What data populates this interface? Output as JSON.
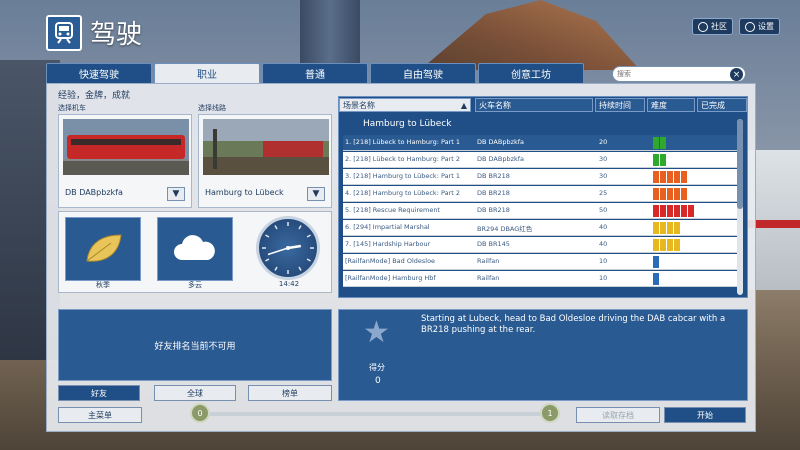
{
  "header": {
    "title": "驾驶"
  },
  "topbar": {
    "community_label": "社区",
    "settings_label": "设置"
  },
  "tabs": [
    {
      "label": "快速驾驶",
      "active": false
    },
    {
      "label": "职业",
      "active": true
    },
    {
      "label": "普通",
      "active": false
    },
    {
      "label": "自由驾驶",
      "active": false
    },
    {
      "label": "创意工坊",
      "active": false
    }
  ],
  "search": {
    "placeholder": "搜索",
    "clear_icon": "×"
  },
  "career": {
    "subheading": "经验，金牌，成就",
    "select_loco_label": "选择机车",
    "select_route_label": "选择线路",
    "loco_name": "DB DABpbzkfa",
    "route_name": "Hamburg to Lübeck",
    "filter_icon": "▼"
  },
  "conditions": {
    "season_label": "秋季",
    "weather_label": "多云",
    "time_label": "14:42"
  },
  "friends": {
    "unavailable_text": "好友排名当前不可用"
  },
  "leaderboard_buttons": {
    "friends": "好友",
    "global": "全球",
    "board": "榜单"
  },
  "footer": {
    "main_menu": "主菜单",
    "load_save": "读取存档",
    "start": "开始"
  },
  "slider": {
    "min": "0",
    "max": "1",
    "value_fraction": 1.0
  },
  "table": {
    "headers": [
      "场景名称",
      "火车名称",
      "持续时间",
      "难度",
      "已完成"
    ],
    "group": "Hamburg to Lübeck",
    "rows": [
      {
        "name": "1. [218] Lübeck to Hamburg: Part 1",
        "train": "DB DABpbzkfa",
        "duration": "20",
        "difficulty": 2,
        "color": "#2ea82e"
      },
      {
        "name": "2. [218] Lübeck to Hamburg: Part 2",
        "train": "DB DABpbzkfa",
        "duration": "30",
        "difficulty": 2,
        "color": "#2ea82e"
      },
      {
        "name": "3. [218] Hamburg to Lübeck: Part 1",
        "train": "DB BR218",
        "duration": "30",
        "difficulty": 5,
        "color": "#e86020"
      },
      {
        "name": "4. [218] Hamburg to Lübeck: Part 2",
        "train": "DB BR218",
        "duration": "25",
        "difficulty": 5,
        "color": "#e86020"
      },
      {
        "name": "5. [218] Rescue Requirement",
        "train": "DB BR218",
        "duration": "50",
        "difficulty": 6,
        "color": "#d82828"
      },
      {
        "name": "6. [294] Impartial Marshal",
        "train": "BR294 DBAG红色",
        "duration": "40",
        "difficulty": 4,
        "color": "#e8b820"
      },
      {
        "name": "7. [145] Hardship Harbour",
        "train": "DB BR145",
        "duration": "40",
        "difficulty": 4,
        "color": "#e8b820"
      },
      {
        "name": "[RailfanMode] Bad Oldesloe",
        "train": "Railfan",
        "duration": "10",
        "difficulty": 1,
        "color": "#2a6ab8"
      },
      {
        "name": "[RailfanMode] Hamburg Hbf",
        "train": "Railfan",
        "duration": "10",
        "difficulty": 1,
        "color": "#2a6ab8"
      }
    ]
  },
  "details": {
    "description": "Starting at Lubeck, head to Bad Oldesloe driving the DAB cabcar with a BR218 pushing at the rear.",
    "score_label": "得分",
    "score_value": "0"
  },
  "clock": {
    "hour": 14,
    "minute": 42
  }
}
